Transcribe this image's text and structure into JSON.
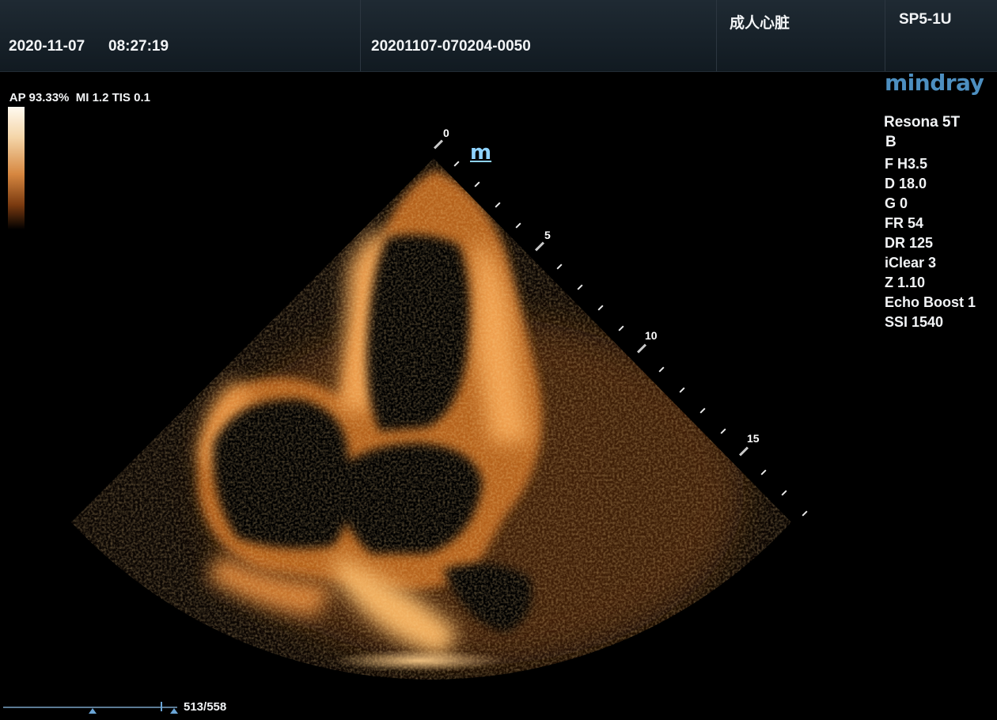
{
  "header": {
    "date": "2020-11-07",
    "time": "08:27:19",
    "exam_id": "20201107-070204-0050",
    "preset": "成人心脏",
    "probe": "SP5-1U"
  },
  "acoustic": {
    "ap": "AP 93.33%",
    "mi": "MI 1.2",
    "tis": "TIS 0.1"
  },
  "brand": {
    "logo": "mindray",
    "color": "#4d8fc0"
  },
  "marker_label": "m",
  "params": {
    "model": "Resona 5T",
    "mode": "B",
    "items": [
      "F H3.5",
      "D 18.0",
      "G 0",
      "FR 54",
      "DR 125",
      "iClear 3",
      "Z 1.10",
      "Echo Boost 1",
      "SSI 1540"
    ]
  },
  "depth_scale": {
    "labels": [
      "0",
      "5",
      "10",
      "15"
    ]
  },
  "cine": {
    "frame": "513/558",
    "position": 0.919
  },
  "colors": {
    "echo": "#f0a050",
    "scale_top": "#fffaf0",
    "background": "#000000"
  },
  "icons": {
    "grayscale_bar": "grayscale-bar-icon",
    "orientation_marker": "m-orientation-icon"
  }
}
